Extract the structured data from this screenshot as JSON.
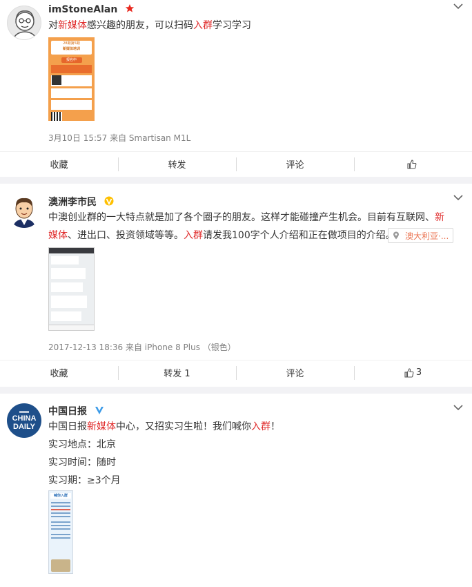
{
  "posts": [
    {
      "user": "imStoneAlan",
      "badge_icon": "star-badge-icon",
      "text_parts": [
        "对",
        "新媒体",
        "感兴趣的朋友，可以扫码",
        "入群",
        "学习学习"
      ],
      "meta": "3月10日 15:57 来自 Smartisan M1L",
      "poster": {
        "header": "28期第5期",
        "title": "新媒体培训",
        "tag": "报名中"
      },
      "actions": {
        "collect": "收藏",
        "repost": "转发",
        "comment": "评论",
        "like_count": ""
      }
    },
    {
      "user": "澳洲李市民",
      "badge_icon": "verified-v-badge-icon",
      "text_parts": [
        "中澳创业群的一大特点就是加了各个圈子的朋友。这样才能碰撞产生机会。目前有互联网、",
        "新媒体",
        "、进出口、投资领域等等。",
        "入群",
        "请发我100字个人介绍和正在做项目的介绍。"
      ],
      "location": "澳大利亚·...",
      "meta": "2017-12-13 18:36 来自 iPhone 8 Plus （银色）",
      "actions": {
        "collect": "收藏",
        "repost": "转发 1",
        "comment": "评论",
        "like_count": "3"
      }
    },
    {
      "user": "中国日报",
      "badge_icon": "verified-v-badge-icon",
      "avatar_text": [
        "CHINA",
        "DAILY"
      ],
      "text_parts": [
        "中国日报",
        "新媒体",
        "中心，又招实习生啦！我们喊你",
        "入群",
        "！"
      ],
      "lines": [
        "实习地点：北京",
        "实习时间：随时",
        "实习期：≥3个月"
      ],
      "poster_title": "喊你入群"
    }
  ],
  "colors": {
    "highlight": "#e02d2d",
    "link_orange": "#eb7350",
    "verified": "#ffc000"
  }
}
